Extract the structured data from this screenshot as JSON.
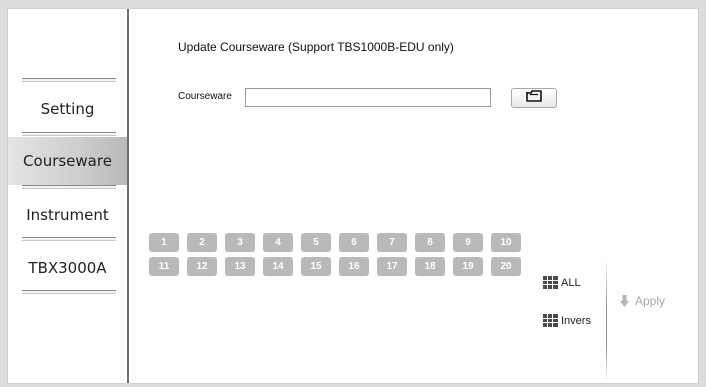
{
  "sidebar": {
    "items": [
      {
        "label": "Setting",
        "active": false
      },
      {
        "label": "Courseware",
        "active": true
      },
      {
        "label": "Instrument",
        "active": false
      },
      {
        "label": "TBX3000A",
        "active": false
      }
    ]
  },
  "main": {
    "title": "Update Courseware (Support TBS1000B-EDU only)",
    "courseware_label": "Courseware",
    "courseware_value": "",
    "browse_icon": "folder-icon",
    "numbers_row1": [
      "1",
      "2",
      "3",
      "4",
      "5",
      "6",
      "7",
      "8",
      "9",
      "10"
    ],
    "numbers_row2": [
      "11",
      "12",
      "13",
      "14",
      "15",
      "16",
      "17",
      "18",
      "19",
      "20"
    ],
    "all_label": "ALL",
    "invers_label": "Invers",
    "apply_label": "Apply"
  },
  "colors": {
    "number_button": "#b9b9b9",
    "active_sidebar": "#cdcdcd",
    "apply_disabled": "#a8a8a8"
  }
}
